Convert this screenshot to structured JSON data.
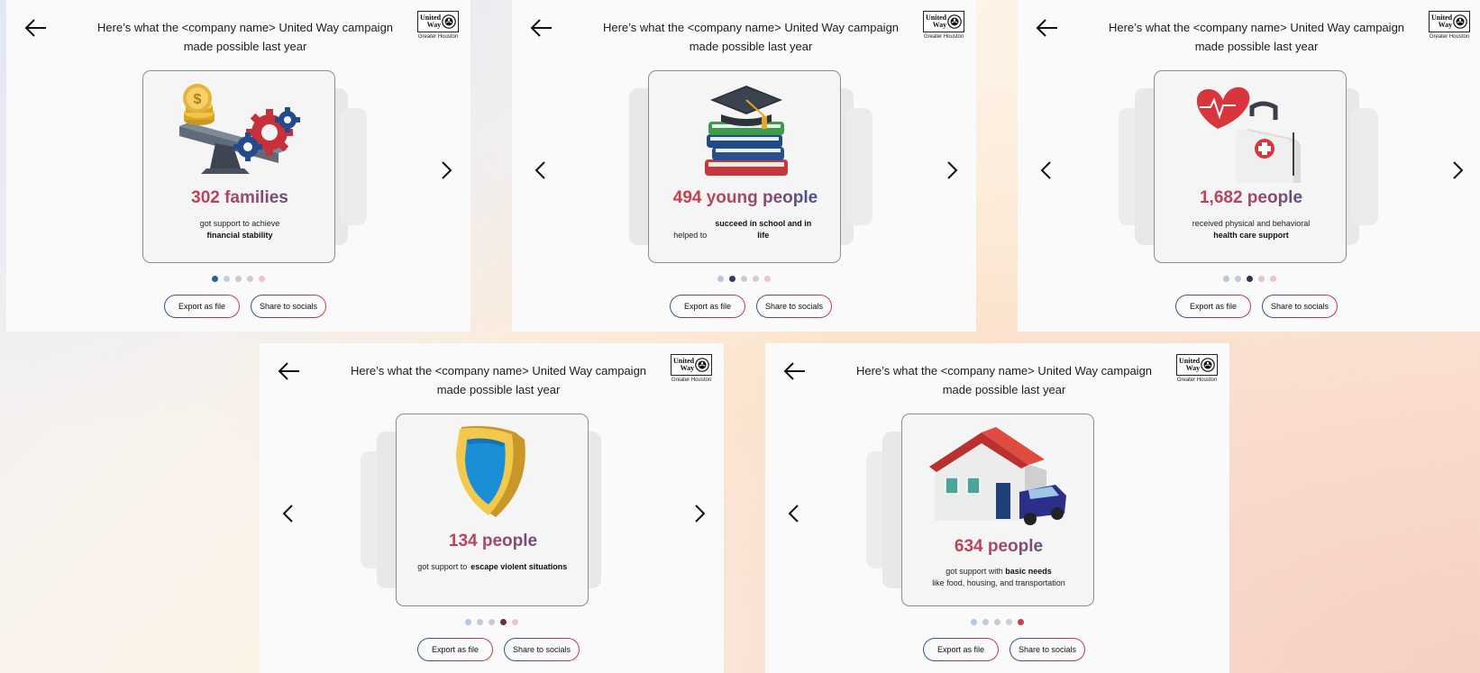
{
  "header_title": "Here’s what the <company name> United Way campaign made possible last year",
  "logo": {
    "word1": "United",
    "word2": "Way",
    "sub": "Greater Houston"
  },
  "buttons": {
    "export": "Export as file",
    "share": "Share to socials"
  },
  "colors": {
    "accent_red": "#d8383c",
    "accent_blue": "#27539a",
    "dot_active_1": "#2d5da8",
    "dot_active_2": "#343a6b",
    "dot_active_3": "#3d2f52",
    "dot_active_4": "#6b2f45",
    "dot_active_5": "#cc3c49"
  },
  "slides": [
    {
      "stat": "302 families",
      "desc_plain": "got support to achieve",
      "desc_bold": "financial stability",
      "illustration": "seesaw-coins-gears-icon",
      "active_index": 0
    },
    {
      "stat": "494 young people",
      "desc_plain": "helped to",
      "desc_bold": "succeed in school and in life",
      "illustration": "books-graduation-cap-icon",
      "active_index": 1
    },
    {
      "stat": "1,682 people",
      "desc_plain": "received physical and behavioral",
      "desc_bold": "health care support",
      "illustration": "heart-medical-kit-icon",
      "active_index": 2
    },
    {
      "stat": "134 people",
      "desc_plain": "got support to",
      "desc_bold": "escape violent situations",
      "illustration": "shield-icon",
      "active_index": 3
    },
    {
      "stat": "634 people",
      "desc_plain": "got support with",
      "desc_bold": "basic needs",
      "desc_extra": "like food, housing, and transportation",
      "illustration": "house-car-icon",
      "active_index": 4
    }
  ]
}
